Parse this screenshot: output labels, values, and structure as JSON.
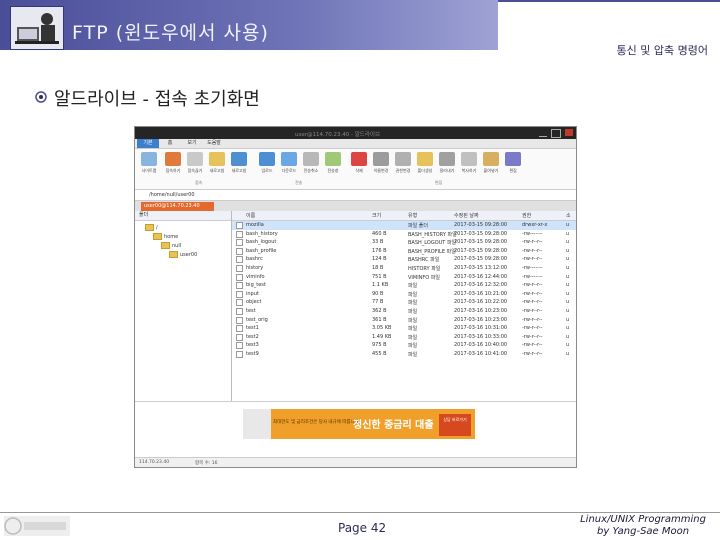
{
  "header": {
    "title": "FTP (윈도우에서 사용)",
    "subtitle": "통신 및 압축 명령어",
    "heading": "알드라이브 - 접속 초기화면"
  },
  "window": {
    "title": "user@114.70.23.40 - 알드라이브",
    "menu_tabs": [
      "기본",
      "홈",
      "보기",
      "도움말"
    ],
    "ribbon_items": [
      "사이트맵",
      "접속하기",
      "접속끊기",
      "새로고침",
      "업로드",
      "다운로드",
      "전송취소",
      "전송창",
      "삭제",
      "이름변경",
      "권한변경",
      "폴더생성",
      "잘라내기",
      "복사하기",
      "붙여넣기",
      "편집",
      "열기"
    ],
    "ribbon_groups": [
      "접속",
      "전송",
      "편집"
    ],
    "address_path": "/home/null/user00",
    "session_tab": "user00@114.70.23.40",
    "tree": {
      "header": "폴더",
      "nodes": [
        "/",
        "home",
        "null",
        "user00"
      ]
    },
    "list": {
      "columns": [
        "이름",
        "크기",
        "유형",
        "수정된 날짜",
        "권한",
        "소"
      ],
      "rows": [
        {
          "name": "mozilla",
          "size": "",
          "type": "파일 폴더",
          "date": "2017-03-15 09:28:00",
          "perm": "drwxr-xr-x",
          "o": "u"
        },
        {
          "name": "bash_history",
          "size": "460 B",
          "type": "BASH_HISTORY 파일",
          "date": "2017-03-15 09:28:00",
          "perm": "-rw-------",
          "o": "u"
        },
        {
          "name": "bash_logout",
          "size": "33 B",
          "type": "BASH_LOGOUT 파일",
          "date": "2017-03-15 09:28:00",
          "perm": "-rw-r--r--",
          "o": "u"
        },
        {
          "name": "bash_profile",
          "size": "176 B",
          "type": "BASH_PROFILE 파일",
          "date": "2017-03-15 09:28:00",
          "perm": "-rw-r--r--",
          "o": "u"
        },
        {
          "name": "bashrc",
          "size": "124 B",
          "type": "BASHRC 파일",
          "date": "2017-03-15 09:28:00",
          "perm": "-rw-r--r--",
          "o": "u"
        },
        {
          "name": "history",
          "size": "18 B",
          "type": "HISTORY 파일",
          "date": "2017-03-15 13:12:00",
          "perm": "-rw-------",
          "o": "u"
        },
        {
          "name": "viminfo",
          "size": "751 B",
          "type": "VIMINFO 파일",
          "date": "2017-03-16 12:44:00",
          "perm": "-rw-------",
          "o": "u"
        },
        {
          "name": "big_test",
          "size": "1.1 KB",
          "type": "파일",
          "date": "2017-03-16 12:32:00",
          "perm": "-rw-r--r--",
          "o": "u"
        },
        {
          "name": "input",
          "size": "90 B",
          "type": "파일",
          "date": "2017-03-16 10:21:00",
          "perm": "-rw-r--r--",
          "o": "u"
        },
        {
          "name": "object",
          "size": "77 B",
          "type": "파일",
          "date": "2017-03-16 10:22:00",
          "perm": "-rw-r--r--",
          "o": "u"
        },
        {
          "name": "test",
          "size": "362 B",
          "type": "파일",
          "date": "2017-03-16 10:23:00",
          "perm": "-rw-r--r--",
          "o": "u"
        },
        {
          "name": "test_orig",
          "size": "361 B",
          "type": "파일",
          "date": "2017-03-16 10:23:00",
          "perm": "-rw-r--r--",
          "o": "u"
        },
        {
          "name": "test1",
          "size": "3.05 KB",
          "type": "파일",
          "date": "2017-03-16 10:31:00",
          "perm": "-rw-r--r--",
          "o": "u"
        },
        {
          "name": "test2",
          "size": "1.49 KB",
          "type": "파일",
          "date": "2017-03-16 10:33:00",
          "perm": "-rw-r--r--",
          "o": "u"
        },
        {
          "name": "test3",
          "size": "975 B",
          "type": "파일",
          "date": "2017-03-16 10:40:00",
          "perm": "-rw-r--r--",
          "o": "u"
        },
        {
          "name": "test9",
          "size": "455 B",
          "type": "파일",
          "date": "2017-03-16 10:41:00",
          "perm": "-rw-r--r--",
          "o": "u"
        }
      ]
    },
    "ad": {
      "small_text": "최대한도 및 금리조건은 당사 내규에 따릅니다.",
      "big_text": "정신한 중금리 대출",
      "button": "상담 바로가기"
    },
    "status": {
      "server": "114.70.23.40",
      "count": "항목 수: 16"
    }
  },
  "footer": {
    "page": "Page 42",
    "credit_line1": "Linux/UNIX Programming",
    "credit_line2": "by Yang-Sae Moon",
    "logo_text": "컴퓨터과학과"
  },
  "colors": {
    "banner": "#4a4e98",
    "accent": "#3d7fcc",
    "session_tab": "#e4692e",
    "ad": "#f0a02a"
  }
}
